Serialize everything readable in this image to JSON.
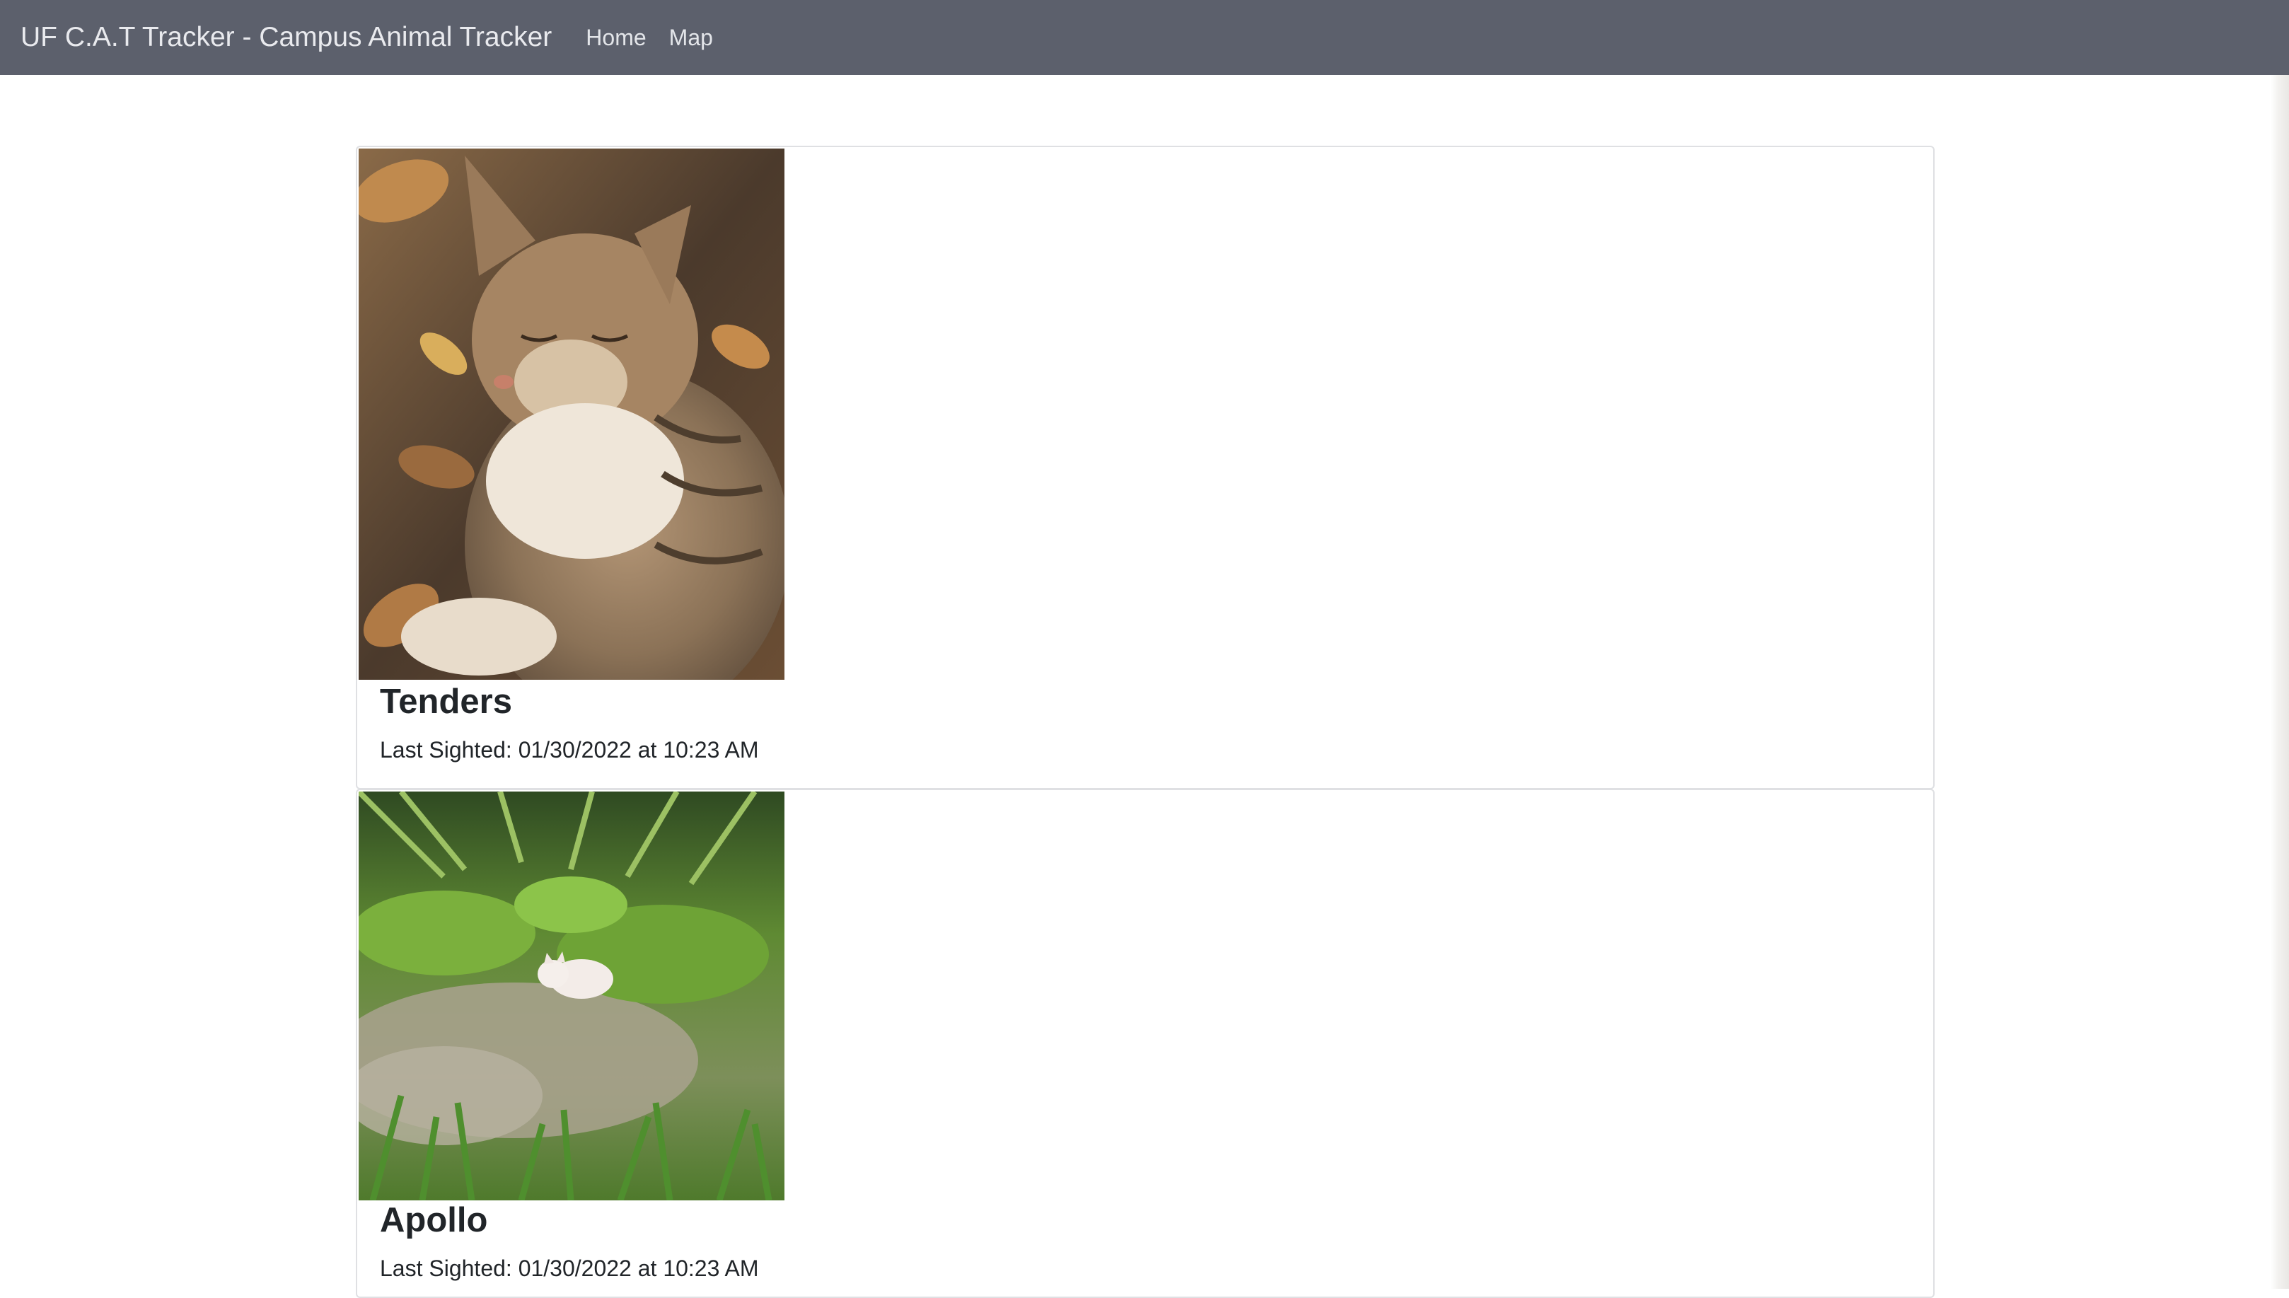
{
  "navbar": {
    "brand": "UF C.A.T Tracker - Campus Animal Tracker",
    "links": [
      {
        "label": "Home"
      },
      {
        "label": "Map"
      }
    ],
    "background": "#5c606c"
  },
  "cats": [
    {
      "name": "Tenders",
      "last_sighted": "Last Sighted: 01/30/2022 at 10:23 AM",
      "photo_icon": "tabby-cat-photo"
    },
    {
      "name": "Apollo",
      "last_sighted": "Last Sighted: 01/30/2022 at 10:23 AM",
      "photo_icon": "white-cat-in-grass-photo"
    }
  ]
}
